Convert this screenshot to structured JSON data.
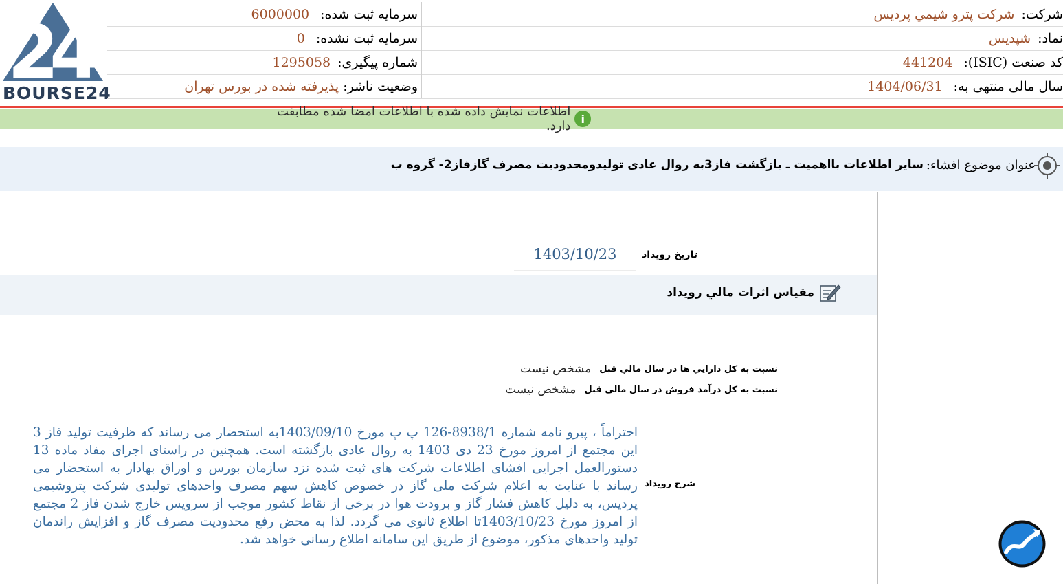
{
  "logo": {
    "text": "BOURSE24",
    "mark": "24"
  },
  "company": {
    "name_label": "شرکت:",
    "name_value": "شرکت پترو شیمي پرديس",
    "symbol_label": "نماد:",
    "symbol_value": "شپدیس",
    "isic_label": "کد صنعت (ISIC):",
    "isic_value": "441204",
    "fiscal_label": "سال مالی منتهی به:",
    "fiscal_value": "1404/06/31",
    "registered_capital_label": "سرمایه ثبت شده:",
    "registered_capital_value": "6000000",
    "unregistered_capital_label": "سرمایه ثبت نشده:",
    "unregistered_capital_value": "0",
    "tracking_label": "شماره پیگیری:",
    "tracking_value": "1295058",
    "publisher_status_label": "وضعیت ناشر:",
    "publisher_status_value": "پذیرفته شده در بورس تهران"
  },
  "notice": {
    "text": "اطلاعات نمایش داده شده با اطلاعات امضا شده مطابقت دارد."
  },
  "topic": {
    "label": "عنوان موضوع افشاء:",
    "value": "سایر اطلاعات بااهمیت ـ بازگشت فاز3به روال عادی تولیدومحدودیت مصرف گازفاز2- گروه ب"
  },
  "event": {
    "date_label": "تاريخ رويداد",
    "date_value": "1403/10/23",
    "section_title": "مقياس اثرات مالي رويداد",
    "ratio_assets_label": "نسبت به کل دارايي ها در سال مالي قبل",
    "ratio_assets_value": "مشخص نيست",
    "ratio_revenue_label": "نسبت به کل درآمد فروش در سال مالي قبل",
    "ratio_revenue_value": "مشخص نيست",
    "description_label": "شرح رويداد",
    "description": "احتراماً ، پیرو نامه شماره 8938/1-126 پ پ مورخ 1403/09/10به استحضار می رساند که ظرفیت تولید فاز 3 این مجتمع از امروز مورخ 23 دی 1403 به روال عادی بازگشته است. همچنین در راستای اجرای مفاد ماده 13 دستورالعمل اجرایی افشای اطلاعات شرکت های ثبت شده نزد سازمان بورس و اوراق بهادار به استحضار می رساند با عنایت به اعلام شرکت ملی گاز در خصوص کاهش سهم مصرف واحدهای تولیدی شرکت پتروشیمی پردیس، به دلیل کاهش فشار گاز و برودت هوا در برخی از نقاط کشور موجب از سرویس خارج شدن فاز 2 مجتمع از امروز مورخ 1403/10/23تا اطلاع ثانوی می گردد. لذا به محض رفع محدودیت مصرف گاز و افزایش راندمان تولید واحدهای مذکور، موضوع از طریق این سامانه اطلاع رسانی خواهد شد."
  },
  "icons": {
    "logo": "bourse24-logo",
    "notice": "info-icon",
    "topic": "target-icon",
    "section": "edit-icon",
    "floating": "chart-trend-icon"
  },
  "colors": {
    "value_text": "#a0522d",
    "accent_red": "#e8433a",
    "notice_bg": "#c6e2b0",
    "description_text": "#3a6ea0",
    "logo_blue": "#4a6f96"
  }
}
